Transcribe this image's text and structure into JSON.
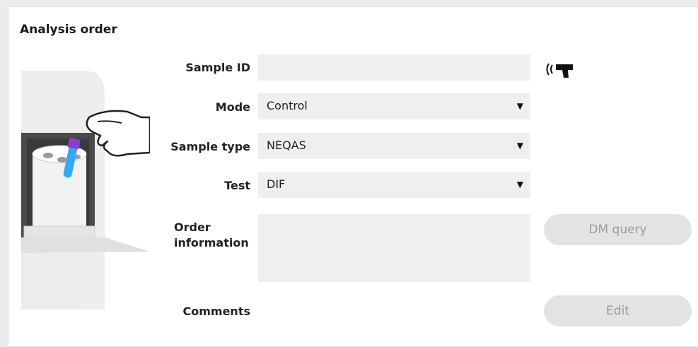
{
  "panel": {
    "title": "Analysis order"
  },
  "form": {
    "sample_id": {
      "label": "Sample ID",
      "value": ""
    },
    "mode": {
      "label": "Mode",
      "value": "Control"
    },
    "sample_type": {
      "label": "Sample type",
      "value": "NEQAS"
    },
    "test": {
      "label": "Test",
      "value": "DIF"
    },
    "order_information": {
      "label_line1": "Order",
      "label_line2": "information",
      "value": ""
    },
    "comments": {
      "label": "Comments"
    }
  },
  "buttons": {
    "dm_query": "DM query",
    "edit": "Edit"
  },
  "icons": {
    "scanner": "barcode-scanner-icon",
    "dropdown": "dropdown-arrow-icon"
  },
  "colors": {
    "field_bg": "#efefef",
    "button_bg": "#e3e3e3",
    "button_text": "#9a9a9a",
    "tube_cap": "#8a3fd0",
    "tube_body": "#34a8f2"
  }
}
